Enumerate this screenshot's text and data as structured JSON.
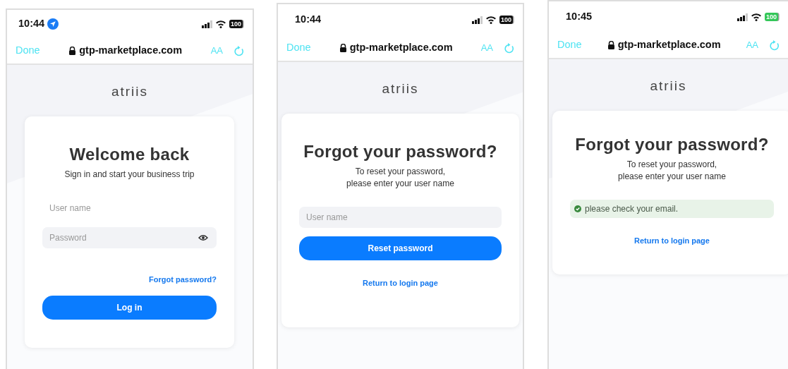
{
  "phones": [
    {
      "status": {
        "time": "10:44",
        "location_active": true,
        "battery": "100",
        "battery_charging": false
      },
      "browser": {
        "done": "Done",
        "url": "gtp-marketplace.com",
        "text_size": "AA"
      },
      "logo": "atriis",
      "card": [
        {
          "kind": "heading",
          "text": "Welcome back"
        },
        {
          "kind": "subtitle",
          "lines": [
            "Sign in and start your business trip"
          ]
        },
        {
          "kind": "field",
          "placeholder": "User name",
          "focused": true
        },
        {
          "kind": "password",
          "placeholder": "Password",
          "focused": false
        },
        {
          "kind": "aside",
          "text": "Forgot password?"
        },
        {
          "kind": "button",
          "text": "Log in"
        }
      ]
    },
    {
      "status": {
        "time": "10:44",
        "location_active": false,
        "battery": "100",
        "battery_charging": false
      },
      "browser": {
        "done": "Done",
        "url": "gtp-marketplace.com",
        "text_size": "AA"
      },
      "logo": "atriis",
      "card": [
        {
          "kind": "heading",
          "text": "Forgot your password?"
        },
        {
          "kind": "subtitle",
          "lines": [
            "To reset your password,",
            "please enter your user name"
          ]
        },
        {
          "kind": "field",
          "placeholder": "User name",
          "focused": false
        },
        {
          "kind": "button",
          "text": "Reset password"
        },
        {
          "kind": "link",
          "text": "Return to login page"
        }
      ]
    },
    {
      "status": {
        "time": "10:45",
        "location_active": false,
        "battery": "100",
        "battery_charging": true
      },
      "browser": {
        "done": "Done",
        "url": "gtp-marketplace.com",
        "text_size": "AA"
      },
      "logo": "atriis",
      "card": [
        {
          "kind": "heading",
          "text": "Forgot your password?"
        },
        {
          "kind": "subtitle",
          "lines": [
            "To reset your password,",
            "please enter your user name"
          ]
        },
        {
          "kind": "alert",
          "text": "please check your email."
        },
        {
          "kind": "link",
          "text": "Return to login page"
        }
      ]
    }
  ]
}
